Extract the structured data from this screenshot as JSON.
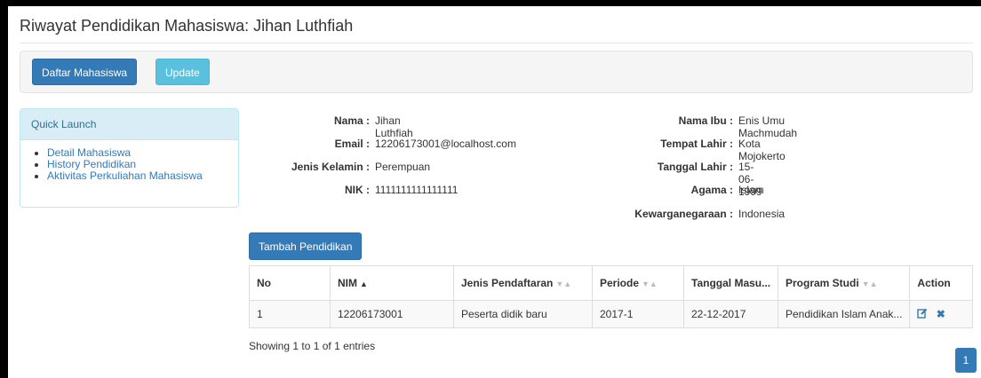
{
  "page": {
    "title": "Riwayat Pendidikan Mahasiswa: Jihan Luthfiah"
  },
  "toolbar": {
    "daftar_label": "Daftar Mahasiswa",
    "update_label": "Update"
  },
  "quick_launch": {
    "heading": "Quick Launch",
    "items": [
      {
        "label": "Detail Mahasiswa"
      },
      {
        "label": "History Pendidikan"
      },
      {
        "label": "Aktivitas Perkuliahan Mahasiswa"
      }
    ]
  },
  "student": {
    "left": [
      {
        "label": "Nama :",
        "value": "Jihan Luthfiah"
      },
      {
        "label": "Email :",
        "value": "12206173001@localhost.com"
      },
      {
        "label": "Jenis Kelamin :",
        "value": "Perempuan"
      },
      {
        "label": "NIK :",
        "value": "1111111111111111"
      }
    ],
    "right": [
      {
        "label": "Nama Ibu :",
        "value": "Enis Umu Machmudah"
      },
      {
        "label": "Tempat Lahir :",
        "value": "Kota Mojokerto"
      },
      {
        "label": "Tanggal Lahir :",
        "value": "15-06-1999"
      },
      {
        "label": "Agama :",
        "value": "Islam"
      },
      {
        "label": "Kewarganegaraan :",
        "value": "Indonesia"
      }
    ]
  },
  "add_button": "Tambah Pendidikan",
  "table": {
    "headers": [
      "No",
      "NIM",
      "Jenis Pendaftaran",
      "Periode",
      "Tanggal Masu...",
      "Program Studi",
      "Action"
    ],
    "rows": [
      {
        "no": "1",
        "nim": "12206173001",
        "jenis": "Peserta didik baru",
        "periode": "2017-1",
        "tanggal": "22-12-2017",
        "prodi": "Pendidikan Islam Anak..."
      }
    ]
  },
  "footer": {
    "showing": "Showing 1 to 1 of 1 entries",
    "page": "1"
  },
  "colors": {
    "primary": "#337ab7",
    "info": "#5bc0de",
    "panel_heading": "#d9edf7"
  }
}
